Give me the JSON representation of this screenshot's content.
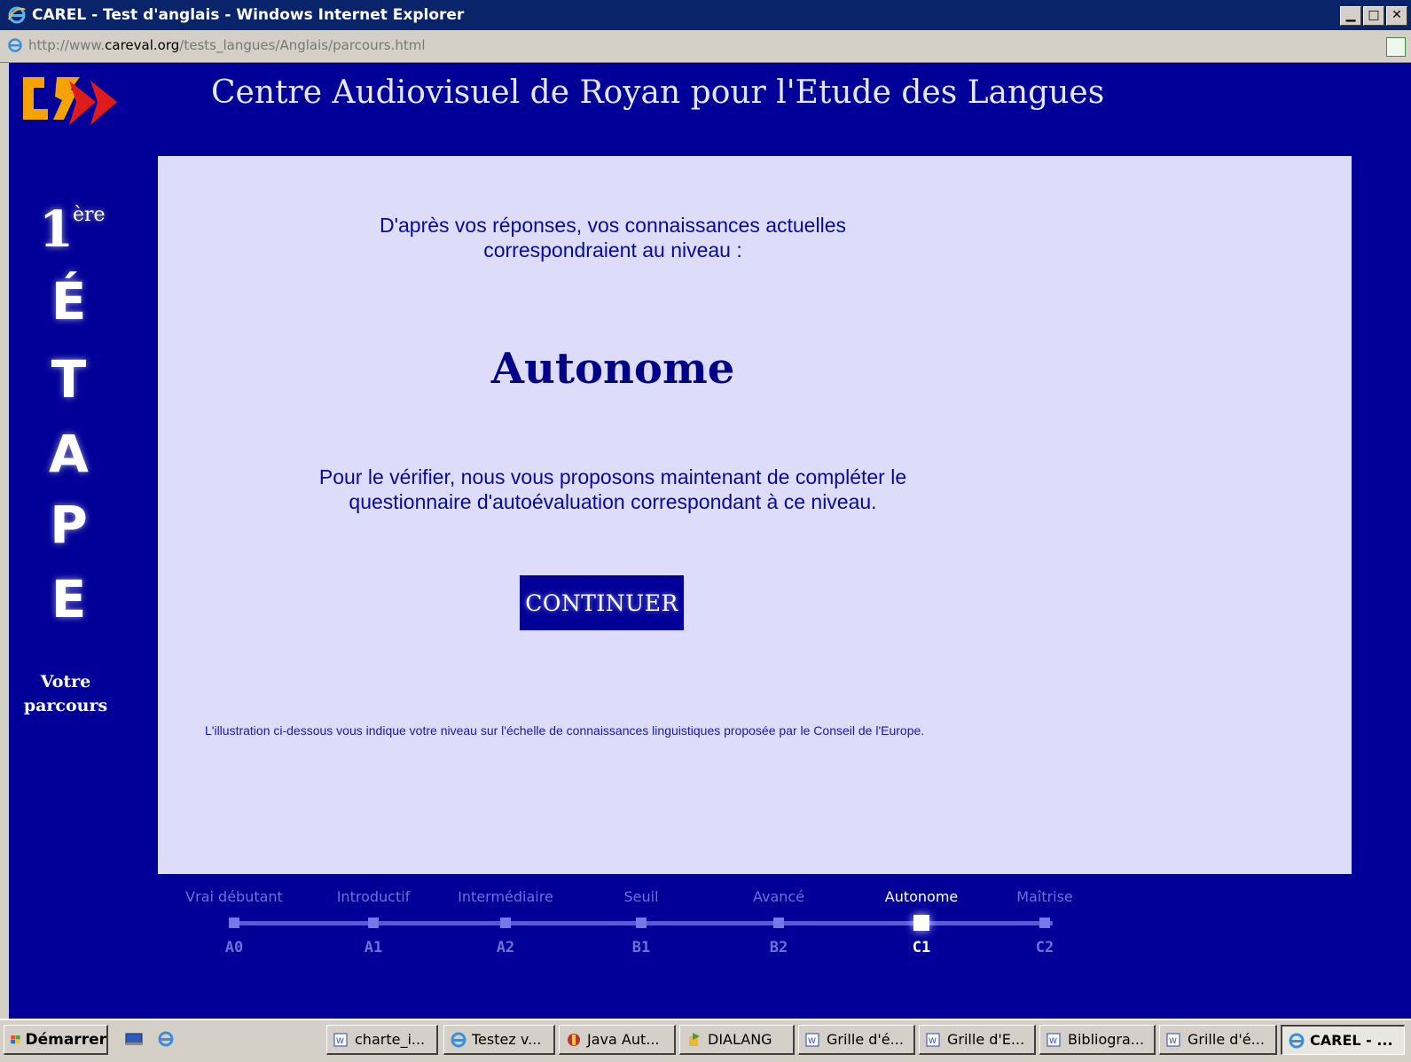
{
  "window": {
    "title": "CAREL - Test d'anglais - Windows Internet Explorer",
    "icon": "ie-icon",
    "controls": [
      "minimize",
      "maximize",
      "close"
    ]
  },
  "address": {
    "prefix": "http://www.",
    "domain": "careval.org",
    "path": "/tests_langues/Anglais/parcours.html"
  },
  "site": {
    "title": "Centre Audiovisuel de Royan pour l'Etude des Langues"
  },
  "sidebar": {
    "step_number": "1",
    "step_suffix": "ère",
    "letters": [
      "É",
      "T",
      "A",
      "P",
      "E"
    ],
    "parcours_line1": "Votre",
    "parcours_line2": "parcours"
  },
  "content": {
    "intro_line1": "D'après vos réponses, vos connaissances actuelles",
    "intro_line2": "correspondraient au niveau :",
    "level": "Autonome",
    "verify_line1": "Pour le vérifier, nous vous proposons maintenant de compléter le",
    "verify_line2": "questionnaire d'autoévaluation correspondant à ce niveau.",
    "continue_label": "CONTINUER",
    "illustration_note": "L'illustration ci-dessous vous indique votre niveau sur l'échelle de connaissances linguistiques proposée par le Conseil de l'Europe."
  },
  "scale": {
    "active_index": 5,
    "levels": [
      {
        "label": "Vrai débutant",
        "code": "A0"
      },
      {
        "label": "Introductif",
        "code": "A1"
      },
      {
        "label": "Intermédiaire",
        "code": "A2"
      },
      {
        "label": "Seuil",
        "code": "B1"
      },
      {
        "label": "Avancé",
        "code": "B2"
      },
      {
        "label": "Autonome",
        "code": "C1"
      },
      {
        "label": "Maîtrise",
        "code": "C2"
      }
    ]
  },
  "taskbar": {
    "start_label": "Démarrer",
    "tasks": [
      {
        "label": "charte_i...",
        "icon": "word-icon"
      },
      {
        "label": "Testez v...",
        "icon": "ie-icon"
      },
      {
        "label": "Java Aut...",
        "icon": "java-icon"
      },
      {
        "label": "DIALANG",
        "icon": "dialang-icon"
      },
      {
        "label": "Grille d'é...",
        "icon": "word-icon"
      },
      {
        "label": "Grille d'E...",
        "icon": "word-icon"
      },
      {
        "label": "Bibliogra...",
        "icon": "word-icon"
      },
      {
        "label": "Grille d'é...",
        "icon": "word-icon"
      },
      {
        "label": "CAREL - ...",
        "icon": "ie-icon",
        "active": true
      }
    ]
  },
  "colors": {
    "page_bg": "#000099",
    "content_bg": "#ddddfb",
    "accent_text": "#0a0a99",
    "logo_orange": "#f5a300",
    "logo_red": "#e01b1b"
  }
}
